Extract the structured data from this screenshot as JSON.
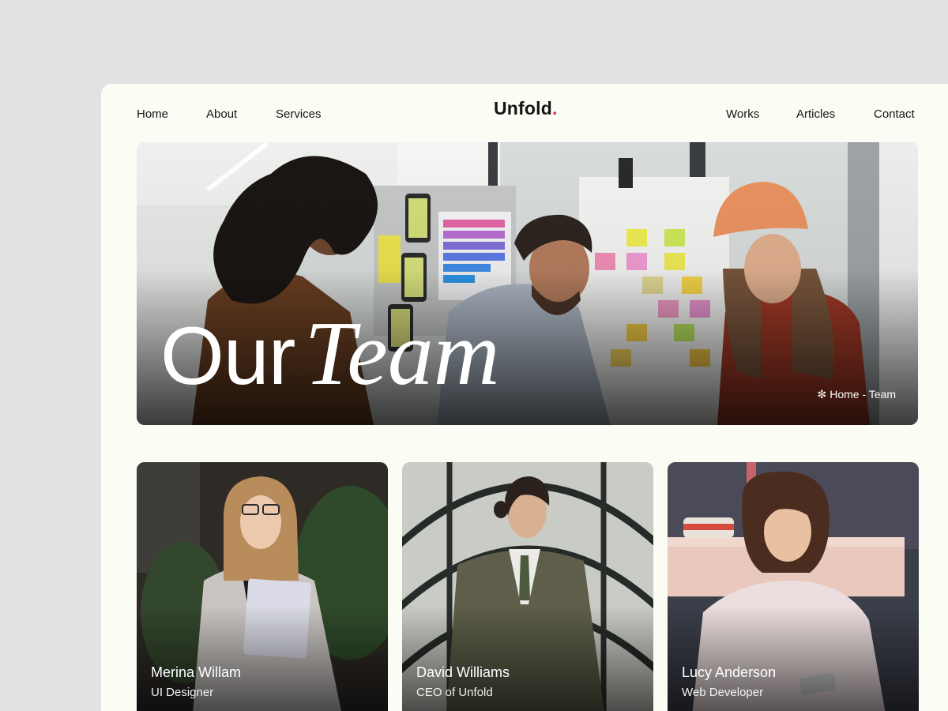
{
  "nav": {
    "left": [
      "Home",
      "About",
      "Services"
    ],
    "right": [
      "Works",
      "Articles",
      "Contact"
    ]
  },
  "brand": {
    "name": "Unfold",
    "dot": ".",
    "accent": "#e3274a"
  },
  "hero": {
    "title_plain": "Our",
    "title_italic": "Team",
    "breadcrumb_icon": "sparkle-icon",
    "breadcrumb": {
      "home": "Home",
      "separator": " - ",
      "current": "Team"
    }
  },
  "team": [
    {
      "name": "Merina Willam",
      "role": "UI Designer"
    },
    {
      "name": "David Williams",
      "role": "CEO of Unfold"
    },
    {
      "name": "Lucy Anderson",
      "role": "Web Developer"
    }
  ]
}
